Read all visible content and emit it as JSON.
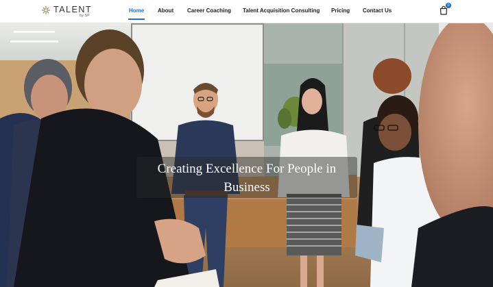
{
  "brand": {
    "name": "TALENT",
    "sub": "by SP",
    "accent": "#1f6fd1"
  },
  "nav": {
    "items": [
      {
        "label": "Home",
        "active": true
      },
      {
        "label": "About",
        "active": false
      },
      {
        "label": "Career Coaching",
        "active": false
      },
      {
        "label": "Talent Acquisition Consulting",
        "active": false
      },
      {
        "label": "Pricing",
        "active": false
      },
      {
        "label": "Contact Us",
        "active": false
      }
    ],
    "cart": {
      "icon": "shopping-bag-icon",
      "count": "0"
    }
  },
  "hero": {
    "headline": "Creating Excellence For People in Business",
    "image": "business-people-meeting-photo"
  }
}
